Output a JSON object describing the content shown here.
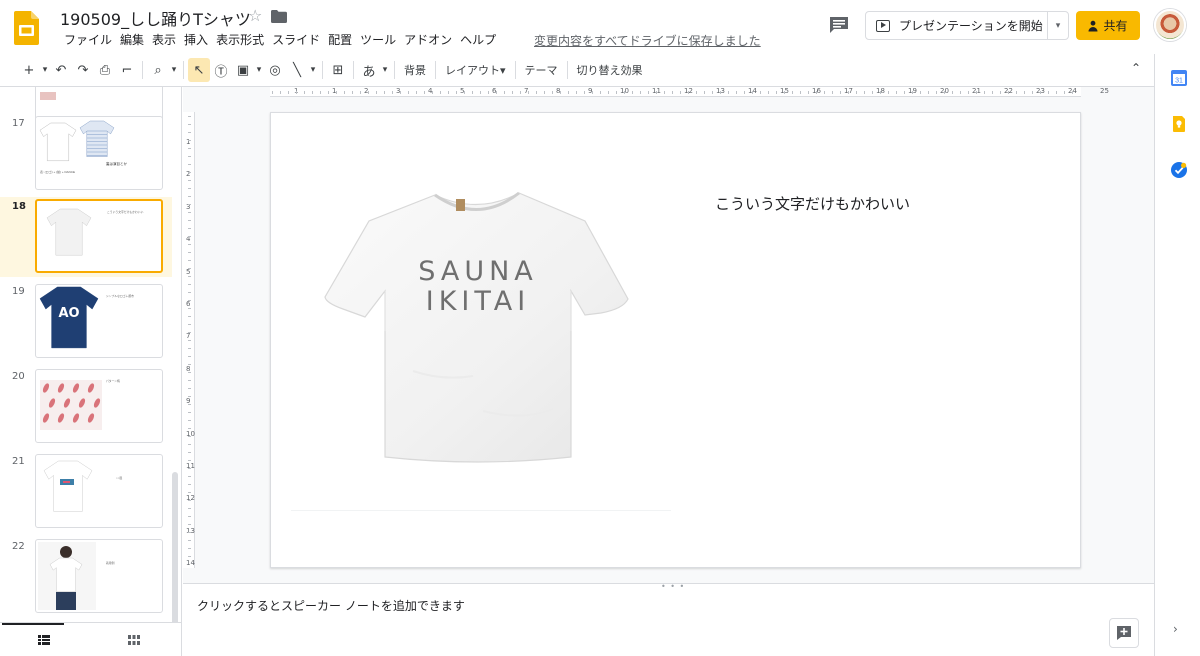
{
  "header": {
    "doc_title": "190509_しし踊りTシャツ",
    "star": "☆",
    "menu": [
      "ファイル",
      "編集",
      "表示",
      "挿入",
      "表示形式",
      "スライド",
      "配置",
      "ツール",
      "アドオン",
      "ヘルプ"
    ],
    "save_status": "変更内容をすべてドライブに保存しました",
    "present_label": "プレゼンテーションを開始",
    "present_caret": "▾",
    "share_label": "共有"
  },
  "toolbar": {
    "items": [
      {
        "name": "new-slide-button",
        "label": "+",
        "interactable": true
      },
      {
        "name": "new-slide-dropdown",
        "label": "▾",
        "interactable": true,
        "small": true
      },
      {
        "name": "undo-button",
        "label": "↶",
        "interactable": true
      },
      {
        "name": "redo-button",
        "label": "↷",
        "interactable": true
      },
      {
        "name": "print-button",
        "label": "⎙",
        "interactable": true
      },
      {
        "name": "paint-format-button",
        "label": "⌐",
        "interactable": true
      },
      {
        "sep": true
      },
      {
        "name": "zoom-button",
        "label": "⌕",
        "interactable": true
      },
      {
        "name": "zoom-dropdown",
        "label": "▾",
        "interactable": true,
        "small": true
      },
      {
        "sep": true
      },
      {
        "name": "select-tool",
        "label": "↖",
        "interactable": true,
        "active": true
      },
      {
        "name": "textbox-tool",
        "label": "Ⓣ",
        "interactable": true
      },
      {
        "name": "image-tool",
        "label": "▣",
        "interactable": true
      },
      {
        "name": "image-dropdown",
        "label": "▾",
        "interactable": true,
        "small": true
      },
      {
        "name": "shape-tool",
        "label": "◎",
        "interactable": true
      },
      {
        "name": "line-tool",
        "label": "╲",
        "interactable": true
      },
      {
        "name": "line-dropdown",
        "label": "▾",
        "interactable": true,
        "small": true
      },
      {
        "sep": true
      },
      {
        "name": "insert-comment-button",
        "label": "⊞",
        "interactable": true
      },
      {
        "sep": true
      },
      {
        "name": "input-tools-button",
        "label": "あ",
        "interactable": true
      },
      {
        "name": "input-tools-dropdown",
        "label": "▾",
        "interactable": true,
        "small": true
      },
      {
        "sep": true
      },
      {
        "name": "background-button",
        "label": "背景",
        "interactable": true,
        "text": true
      },
      {
        "sep": true
      },
      {
        "name": "layout-button",
        "label": "レイアウト▾",
        "interactable": true,
        "text": true
      },
      {
        "sep": true
      },
      {
        "name": "theme-button",
        "label": "テーマ",
        "interactable": true,
        "text": true
      },
      {
        "sep": true
      },
      {
        "name": "transition-button",
        "label": "切り替え効果",
        "interactable": true,
        "text": true
      }
    ],
    "collapse": "⌃"
  },
  "ruler": {
    "h_labels": [
      "1",
      "1",
      "2",
      "3",
      "4",
      "5",
      "6",
      "7",
      "8",
      "9",
      "10",
      "11",
      "12",
      "13",
      "14",
      "15",
      "16",
      "17",
      "18",
      "19",
      "20",
      "21",
      "22",
      "23",
      "24",
      "25"
    ],
    "v_labels": [
      "1",
      "2",
      "3",
      "4",
      "5",
      "6",
      "7",
      "8",
      "9",
      "10",
      "11",
      "12",
      "13",
      "14"
    ]
  },
  "filmstrip": {
    "slides": [
      {
        "num": "",
        "type": "partial"
      },
      {
        "num": "17",
        "type": "shirts-two",
        "caption_left": "表: (ロゴ) + (絵) + DANCE",
        "caption_right": "裏は演目とか"
      },
      {
        "num": "18",
        "type": "shirt-sauna",
        "selected": true,
        "caption": "こういう文字だけもかわいい"
      },
      {
        "num": "19",
        "type": "shirt-navy",
        "caption": "シンプルなロゴ＋都市"
      },
      {
        "num": "20",
        "type": "pattern",
        "caption": "パターン柄"
      },
      {
        "num": "21",
        "type": "shirt-graphic",
        "caption": "○○風"
      },
      {
        "num": "22",
        "type": "model",
        "caption": "着用例"
      }
    ]
  },
  "slide": {
    "text": "こういう文字だけもかわいい",
    "shirt_print": [
      "SAUNA",
      "IKITAI"
    ]
  },
  "notes": {
    "placeholder": "クリックするとスピーカー ノートを追加できます",
    "dots": "• • •"
  },
  "sidepanel": {
    "calendar_badge": "31",
    "expand": "›"
  },
  "colors": {
    "accent": "#f9b900",
    "selection_border": "#f9ab00",
    "selection_bg": "#fef7e0",
    "calendar_blue": "#4285f4",
    "keep_yellow": "#fbbc04",
    "tasks_blue": "#1a73e8",
    "navy_shirt": "#1f3f73"
  }
}
